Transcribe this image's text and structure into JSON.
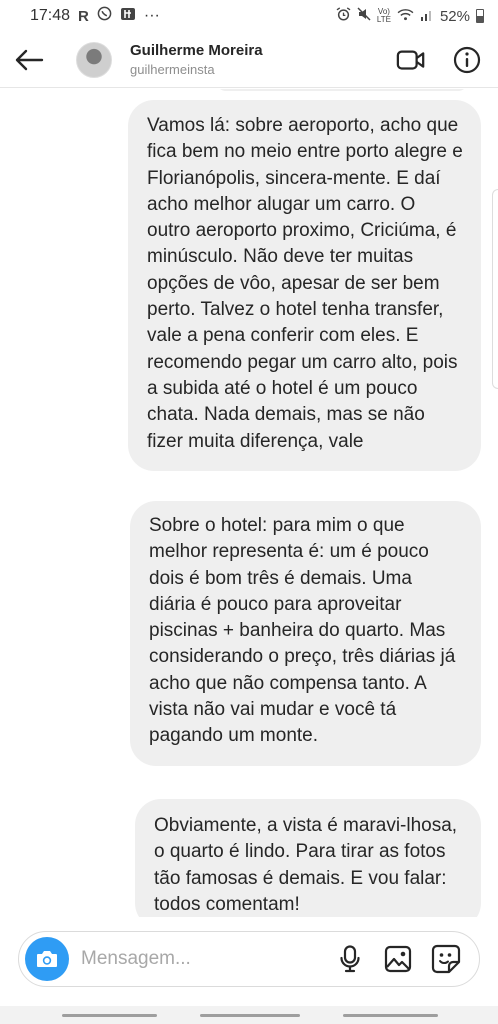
{
  "status_bar": {
    "time": "17:48",
    "left_icons": [
      "R",
      "whatsapp-icon",
      "fanpage-icon",
      "more-dots"
    ],
    "volte": "VoLTE",
    "battery": "52%"
  },
  "header": {
    "name": "Guilherme Moreira",
    "handle": "guilhermeinsta"
  },
  "messages": [
    {
      "text": "Vamos lá: sobre aeroporto, acho que fica bem no meio entre porto alegre e Florianópolis, sincera-mente. E daí acho melhor alugar um carro. O outro aeroporto proximo, Criciúma, é minúsculo. Não deve ter muitas opções de vôo, apesar de ser bem perto. Talvez o hotel tenha transfer, vale a pena conferir com eles. E recomendo pegar um carro alto, pois a subida até o hotel é um pouco chata. Nada demais, mas se não fizer muita diferença, vale"
    },
    {
      "text": "Sobre o hotel: para mim o que melhor representa é: um é pouco dois é bom três é demais. Uma diária é pouco para aproveitar piscinas + banheira do quarto. Mas considerando o preço, três diárias já acho que não compensa tanto. A vista não vai mudar e você tá pagando um monte."
    },
    {
      "text": "Obviamente, a vista é maravi-lhosa, o quarto é lindo. Para tirar as fotos tão famosas é demais. E vou falar: todos comentam!"
    }
  ],
  "composer": {
    "placeholder": "Mensagem..."
  },
  "colors": {
    "bubble": "#efefef",
    "camera_button": "#2f9cf4",
    "handle_text": "#8e8e8e"
  }
}
